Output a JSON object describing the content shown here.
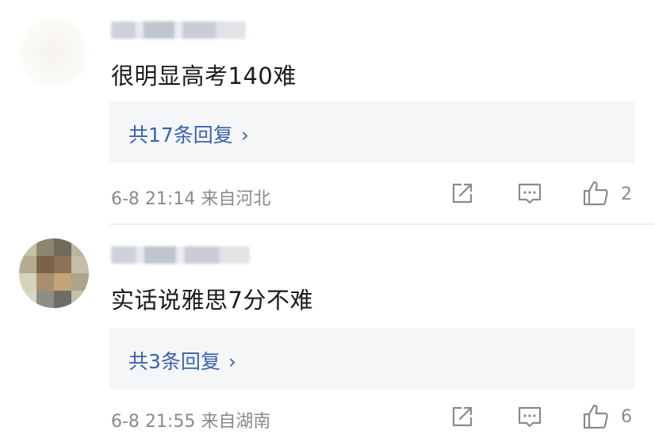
{
  "comments": [
    {
      "text": "很明显高考140难",
      "replies_label": "共17条回复",
      "chevron": "›",
      "meta": "6-8 21:14 来自河北",
      "likes": "2"
    },
    {
      "text": "实话说雅思7分不难",
      "replies_label": "共3条回复",
      "chevron": "›",
      "meta": "6-8 21:55 来自湖南",
      "likes": "6"
    }
  ],
  "icons": {
    "share": "share-icon",
    "reply": "comment-icon",
    "like": "thumbs-up-icon"
  },
  "colors": {
    "link": "#3a62ad",
    "meta": "#8a8a8a",
    "reply_bg": "#f5f6f8"
  }
}
